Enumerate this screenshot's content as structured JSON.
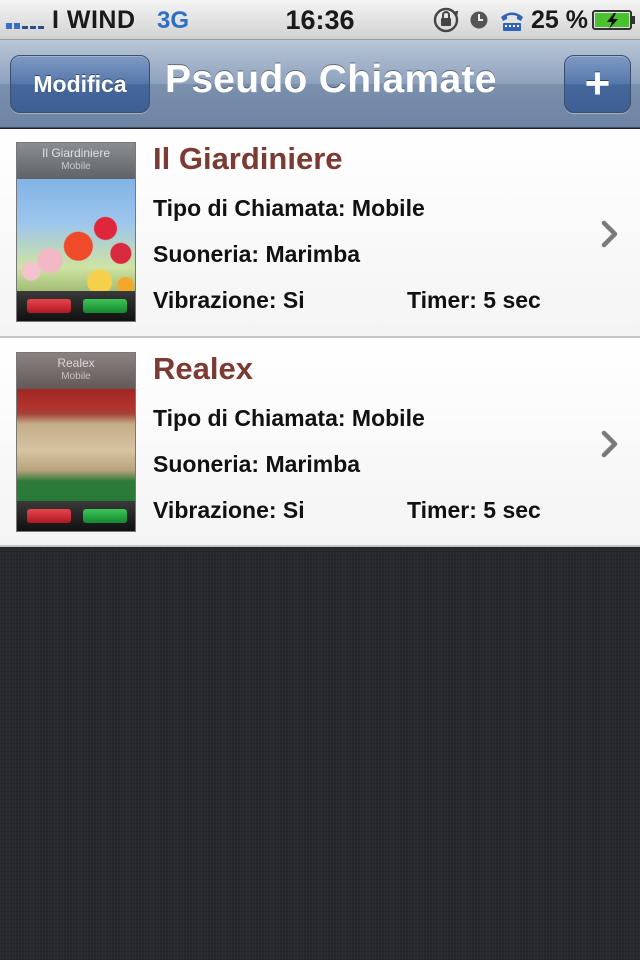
{
  "status_bar": {
    "carrier": "I WIND",
    "network": "3G",
    "time": "16:36",
    "battery": "25 %",
    "icons": [
      "signal-icon",
      "orientation-lock-icon",
      "alarm-icon",
      "tty-icon",
      "battery-charging-icon"
    ]
  },
  "nav": {
    "edit_label": "Modifica",
    "title": "Pseudo Chiamate",
    "add_label": "+"
  },
  "entries": [
    {
      "name": "Il Giardiniere",
      "thumb_title": "Il Giardiniere",
      "thumb_sub": "Mobile",
      "type": "Tipo di Chiamata: Mobile",
      "ringtone": "Suoneria: Marimba",
      "vibration": "Vibrazione: Si",
      "timer": "Timer: 5 sec"
    },
    {
      "name": "Realex",
      "thumb_title": "Realex",
      "thumb_sub": "Mobile",
      "type": "Tipo di Chiamata: Mobile",
      "ringtone": "Suoneria: Marimba",
      "vibration": "Vibrazione: Si",
      "timer": "Timer: 5 sec"
    }
  ],
  "colors": {
    "entry_name": "#7b3a32",
    "nav_button": "#4a6ca2",
    "network": "#2e6fc4"
  }
}
